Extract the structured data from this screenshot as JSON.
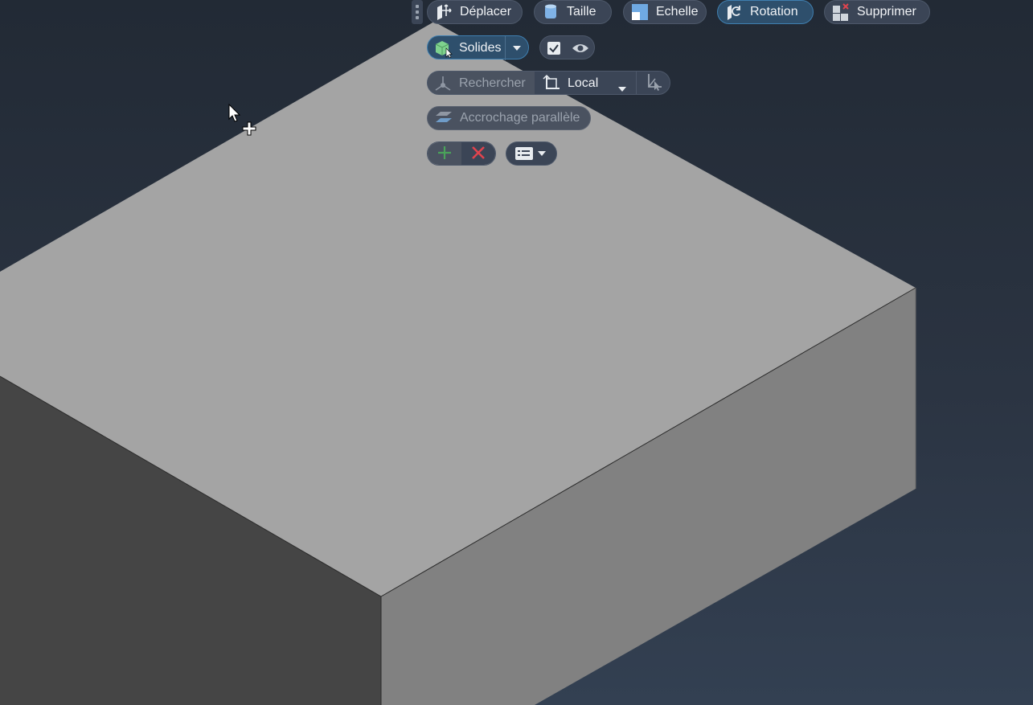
{
  "toolbar": {
    "move_label": "Déplacer",
    "size_label": "Taille",
    "scale_label": "Echelle",
    "rotate_label": "Rotation",
    "delete_label": "Supprimer"
  },
  "selection": {
    "filter_label": "Solides"
  },
  "search": {
    "label": "Rechercher",
    "coord_system": "Local"
  },
  "snap": {
    "label": "Accrochage parallèle"
  },
  "icons": {
    "move": "move-arrows-icon",
    "size": "cylinder-size-icon",
    "scale": "scale-squares-icon",
    "rotate": "rotate-icon",
    "delete": "delete-grid-icon",
    "solids": "cube-cursor-icon",
    "visibility": "eye-icon",
    "coord": "local-frame-icon",
    "add": "plus-icon",
    "remove": "x-icon",
    "options": "list-menu-icon"
  },
  "colors": {
    "accent": "#3f7fb0",
    "top_face": "#a4a4a4",
    "right_face": "#818181",
    "left_face": "#454545",
    "remove_red": "#e0444e",
    "add_green": "#4aa35a"
  }
}
